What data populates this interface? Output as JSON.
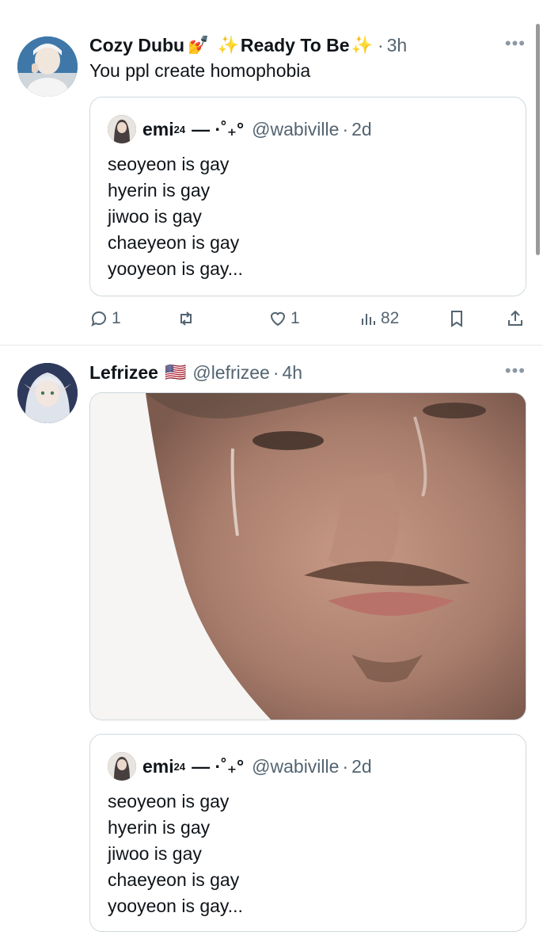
{
  "tweet1": {
    "name": "Cozy Dubu",
    "name_emoji": "💅",
    "spark1": "✨",
    "name_suffix": "Ready To Be",
    "spark2": "✨",
    "time": "3h",
    "more": "•••",
    "text": "You ppl create homophobia",
    "quote": {
      "name": "emi",
      "sup": "24",
      "deco": "— ·˚₊°",
      "handle": "@wabiville",
      "time": "2d",
      "lines": [
        "seoyeon is gay",
        "hyerin is gay",
        "jiwoo is gay",
        "chaeyeon is gay",
        "yooyeon is gay..."
      ]
    },
    "actions": {
      "replies": "1",
      "likes": "1",
      "views": "82"
    }
  },
  "tweet2": {
    "name": "Lefrizee",
    "flag": "🇺🇸",
    "handle": "@lefrizee",
    "time": "4h",
    "more": "•••",
    "quote": {
      "name": "emi",
      "sup": "24",
      "deco": "— ·˚₊°",
      "handle": "@wabiville",
      "time": "2d",
      "lines": [
        "seoyeon is gay",
        "hyerin is gay",
        "jiwoo is gay",
        "chaeyeon is gay",
        "yooyeon is gay..."
      ]
    }
  },
  "colors": {
    "text": "#0f1419",
    "muted": "#536471",
    "border": "#cfd9de",
    "sparkle": "#f5b500"
  }
}
